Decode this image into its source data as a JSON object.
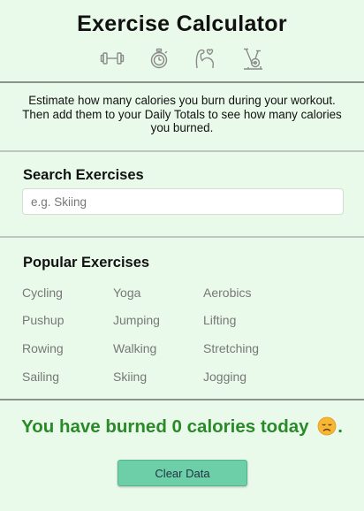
{
  "header": {
    "title": "Exercise Calculator",
    "icons": [
      "dumbbell-icon",
      "stopwatch-icon",
      "flexing-heart-icon",
      "exercise-bike-icon"
    ]
  },
  "description": "Estimate how many calories you burn during your workout. Then add them to your Daily Totals to see how many calories you burned.",
  "search": {
    "heading": "Search Exercises",
    "placeholder": "e.g. Skiing",
    "value": ""
  },
  "popular": {
    "heading": "Popular Exercises",
    "items": [
      "Cycling",
      "Yoga",
      "Aerobics",
      "Pushup",
      "Jumping",
      "Lifting",
      "Rowing",
      "Walking",
      "Stretching",
      "Sailing",
      "Skiing",
      "Jogging"
    ]
  },
  "summary": {
    "prefix": "You have burned",
    "calories": "0",
    "suffix": "calories today",
    "emoji": "sad-face-icon",
    "end": "."
  },
  "clear_button": "Clear Data",
  "colors": {
    "background": "#eafaea",
    "accent_green": "#2a8a2a",
    "button": "#6ccfa7",
    "muted_text": "#777777"
  }
}
